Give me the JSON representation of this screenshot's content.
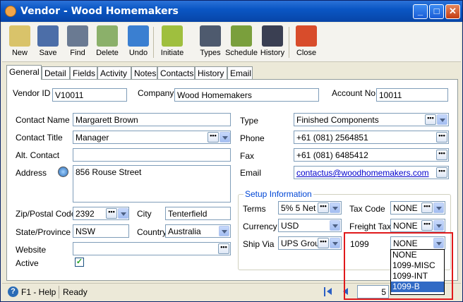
{
  "window": {
    "title": "Vendor - Wood Homemakers",
    "controls": [
      "_",
      "□",
      "✕"
    ]
  },
  "toolbar": {
    "buttons": [
      {
        "label": "New",
        "color": "#d9c36a"
      },
      {
        "label": "Save",
        "color": "#4c6ea8"
      },
      {
        "label": "Find",
        "color": "#6a7a92"
      },
      {
        "label": "Delete",
        "color": "#8bb06a"
      },
      {
        "label": "Undo",
        "color": "#3a7fd1"
      },
      {
        "label": "Initiate",
        "color": "#9fbf3e"
      },
      {
        "label": "Types",
        "color": "#4e5a6e"
      },
      {
        "label": "Schedule",
        "color": "#7a9f3c"
      },
      {
        "label": "History",
        "color": "#3a3f52"
      },
      {
        "label": "Close",
        "color": "#d84c2b"
      }
    ]
  },
  "tabs": [
    "General",
    "Detail",
    "Fields",
    "Activity",
    "Notes",
    "Contacts",
    "History",
    "Email"
  ],
  "form": {
    "vendor_id_label": "Vendor ID",
    "vendor_id": "V10011",
    "company_label": "Company",
    "company": "Wood Homemakers",
    "account_no_label": "Account No",
    "account_no": "10011",
    "contact_name_label": "Contact Name",
    "contact_name": "Margarett Brown",
    "contact_title_label": "Contact Title",
    "contact_title": "Manager",
    "alt_contact_label": "Alt. Contact",
    "alt_contact": "",
    "address_label": "Address",
    "address": "856 Rouse Street",
    "zip_label": "Zip/Postal Code",
    "zip": "2392",
    "city_label": "City",
    "city": "Tenterfield",
    "state_label": "State/Province",
    "state": "NSW",
    "country_label": "Country",
    "country": "Australia",
    "website_label": "Website",
    "website": "",
    "active_label": "Active",
    "active_mark": "✓",
    "type_label": "Type",
    "type": "Finished Components",
    "phone_label": "Phone",
    "phone": "+61 (081) 2564851",
    "fax_label": "Fax",
    "fax": "+61 (081) 6485412",
    "email_label": "Email",
    "email": "contactus@woodhomemakers.com"
  },
  "setup": {
    "legend": "Setup Information",
    "terms_label": "Terms",
    "terms": "5% 5 Net",
    "tax_code_label": "Tax Code",
    "tax_code": "NONE",
    "currency_label": "Currency",
    "currency": "USD",
    "freight_tax_label": "Freight Tax",
    "freight_tax": "NONE",
    "ship_via_label": "Ship Via",
    "ship_via": "UPS Grou",
    "form1099_label": "1099",
    "form1099": "NONE"
  },
  "dropdown_1099": {
    "options": [
      "NONE",
      "1099-MISC",
      "1099-INT",
      "1099-B"
    ],
    "selected": "1099-B"
  },
  "status": {
    "help": "F1 - Help",
    "state": "Ready",
    "record": "5"
  }
}
